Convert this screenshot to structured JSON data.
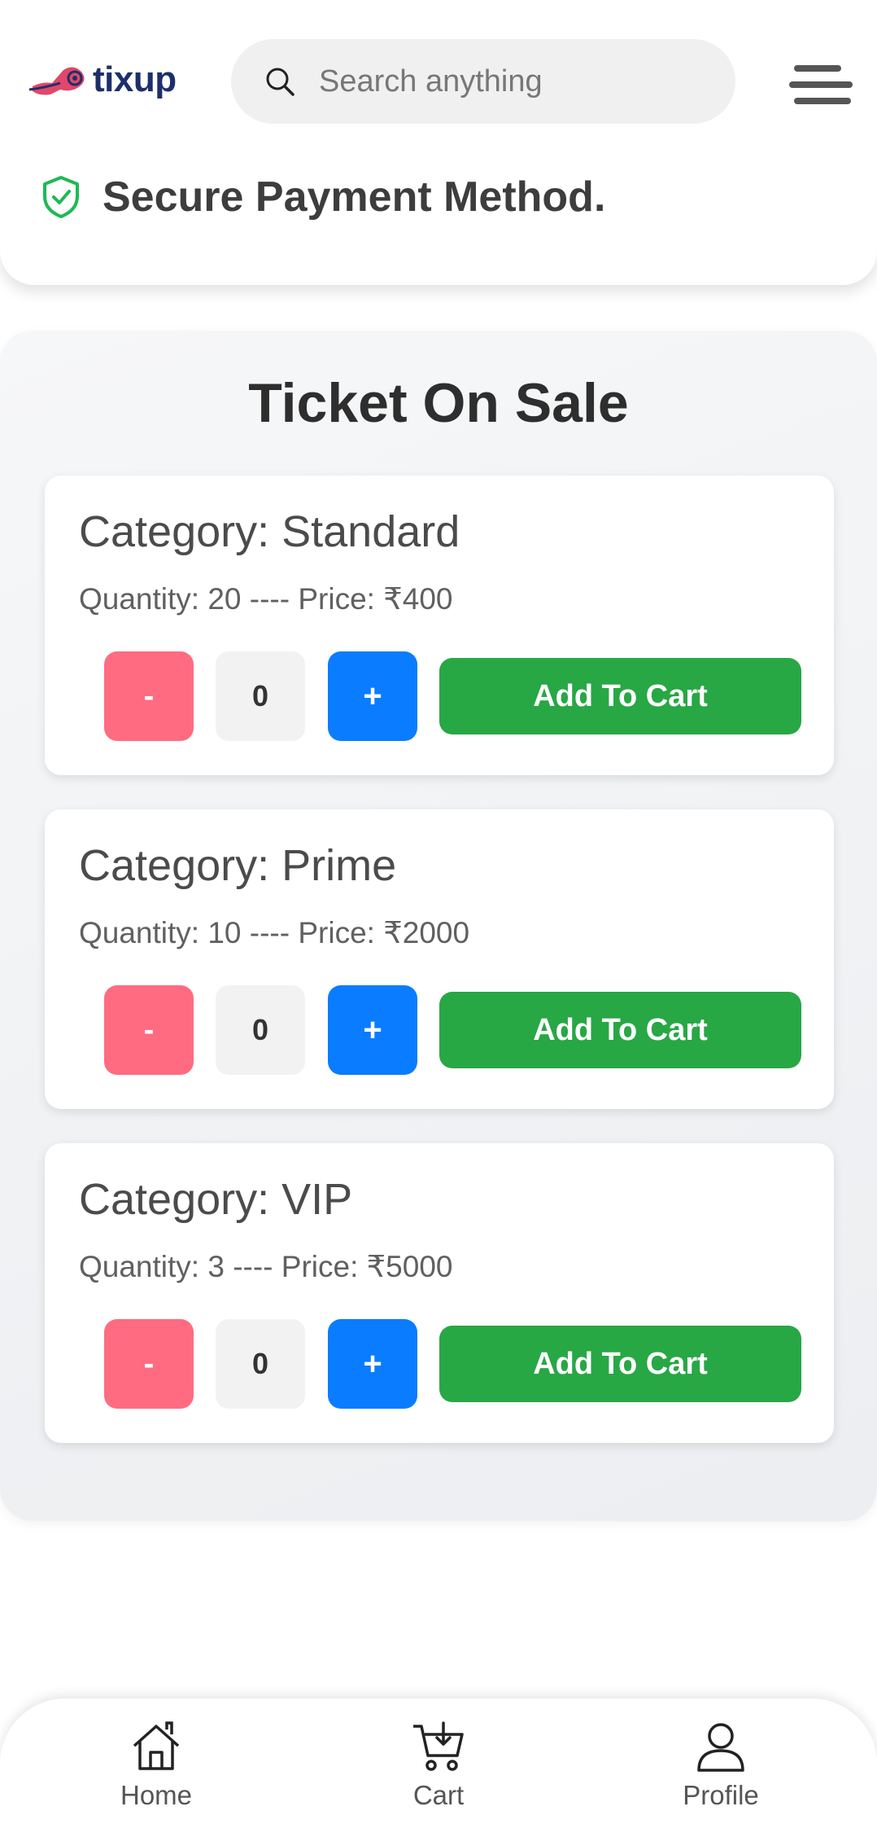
{
  "header": {
    "logo_text": "tixup",
    "search": {
      "placeholder": "Search anything",
      "value": ""
    },
    "secure_text": "Secure Payment Method."
  },
  "tickets": {
    "title": "Ticket On Sale",
    "items": [
      {
        "category": "Category: Standard",
        "info": "Quantity: 20 ---- Price: ₹400",
        "minus": "-",
        "qty": "0",
        "plus": "+",
        "add": "Add To Cart"
      },
      {
        "category": "Category: Prime",
        "info": "Quantity: 10 ---- Price: ₹2000",
        "minus": "-",
        "qty": "0",
        "plus": "+",
        "add": "Add To Cart"
      },
      {
        "category": "Category: VIP",
        "info": "Quantity: 3 ---- Price: ₹5000",
        "minus": "-",
        "qty": "0",
        "plus": "+",
        "add": "Add To Cart"
      }
    ]
  },
  "nav": {
    "items": [
      {
        "label": "Home",
        "icon": "home-icon"
      },
      {
        "label": "Cart",
        "icon": "cart-icon"
      },
      {
        "label": "Profile",
        "icon": "profile-icon"
      }
    ]
  },
  "colors": {
    "minus": "#ff6b81",
    "plus": "#0a7cff",
    "add_to_cart": "#28a745",
    "shield": "#1db954",
    "logo_text": "#1d2f6b",
    "logo_mark": "#e0476a"
  }
}
